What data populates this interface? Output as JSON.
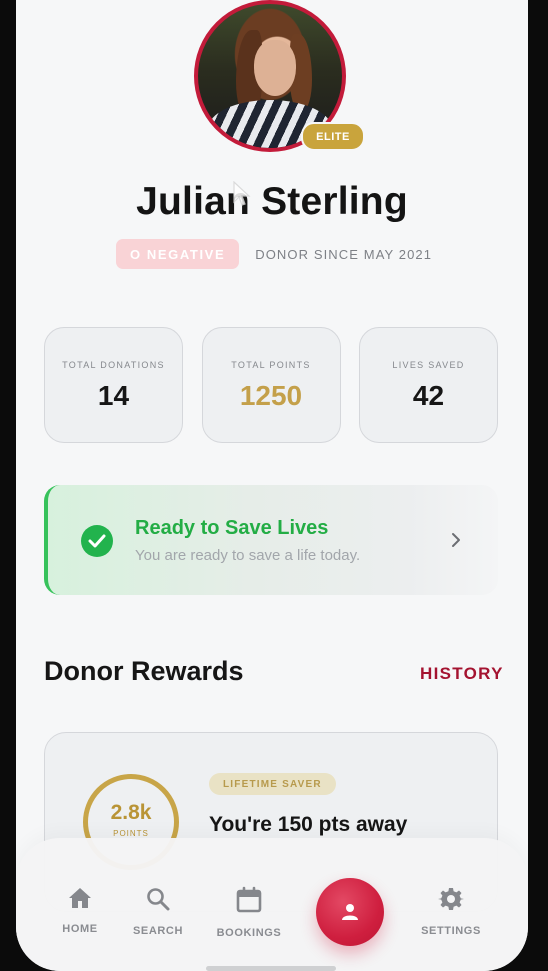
{
  "profile": {
    "badge": "ELITE",
    "name": "Julian Sterling",
    "blood_type": "O NEGATIVE",
    "donor_since": "DONOR SINCE MAY 2021"
  },
  "stats": [
    {
      "label": "TOTAL DONATIONS",
      "value": "14"
    },
    {
      "label": "TOTAL POINTS",
      "value": "1250"
    },
    {
      "label": "LIVES SAVED",
      "value": "42"
    }
  ],
  "status": {
    "title": "Ready to Save Lives",
    "subtitle": "You are ready to save a life today."
  },
  "rewards": {
    "title": "Donor Rewards",
    "history_label": "HISTORY",
    "points_value": "2.8k",
    "points_sub": "POINTS",
    "tier": "LIFETIME SAVER",
    "progress_text": "You're 150 pts away"
  },
  "nav": {
    "home": "HOME",
    "search": "SEARCH",
    "bookings": "BOOKINGS",
    "settings": "SETTINGS"
  },
  "colors": {
    "brand_red": "#c31b3a",
    "gold": "#c4a04a",
    "success_green": "#23ad45"
  }
}
